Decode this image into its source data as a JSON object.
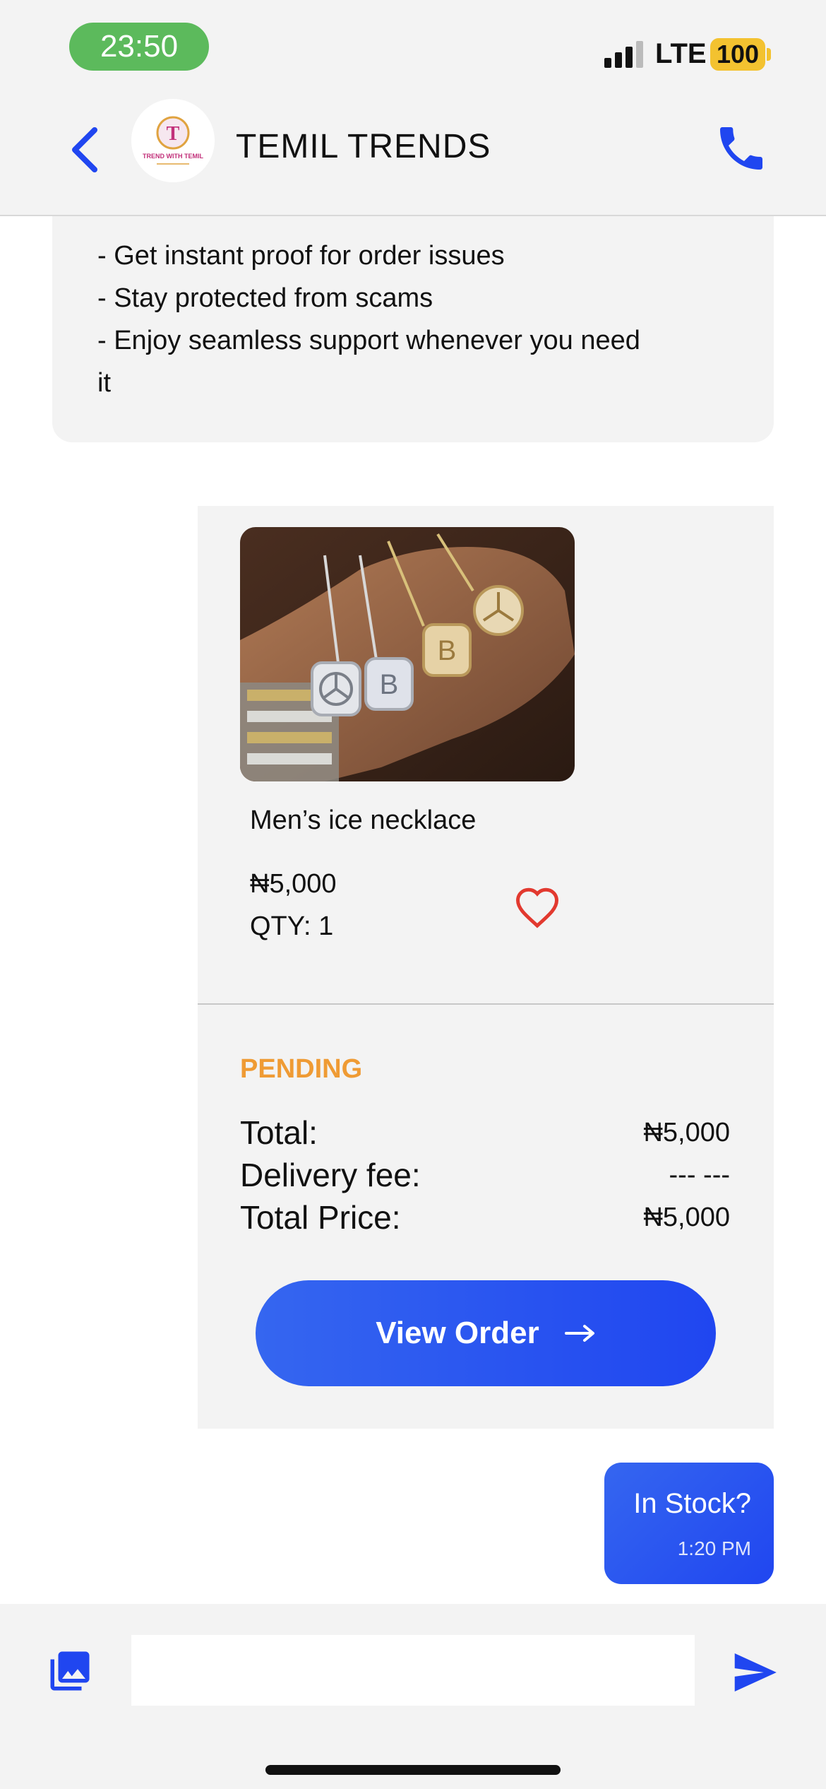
{
  "status_bar": {
    "time": "23:50",
    "network": "LTE",
    "battery": "100"
  },
  "header": {
    "shop_name": "TEMIL TRENDS",
    "avatar_text": "TREND WITH TEMIL",
    "avatar_initial": "T"
  },
  "info_message": {
    "lines": [
      "- Get instant proof for order issues",
      "- Stay protected from scams",
      "- Enjoy seamless support whenever you need",
      "it"
    ]
  },
  "product": {
    "name": "Men’s ice necklace",
    "price": "₦5,000",
    "qty": "QTY: 1"
  },
  "order": {
    "status": "PENDING",
    "total_label": "Total:",
    "total_value": "₦5,000",
    "delivery_label": "Delivery fee:",
    "delivery_value": "--- ---",
    "total_price_label": "Total Price:",
    "total_price_value": "₦5,000",
    "view_order_label": "View Order"
  },
  "sent_message": {
    "text": "In Stock?",
    "time": "1:20 PM"
  },
  "composer": {
    "placeholder": ""
  },
  "colors": {
    "accent": "#2046f0",
    "pending": "#ef9b34",
    "heart": "#e2392f",
    "time_pill": "#5cba5c"
  },
  "icons": [
    "back-icon",
    "call-icon",
    "heart-icon",
    "arrow-right-icon",
    "gallery-icon",
    "send-icon"
  ]
}
